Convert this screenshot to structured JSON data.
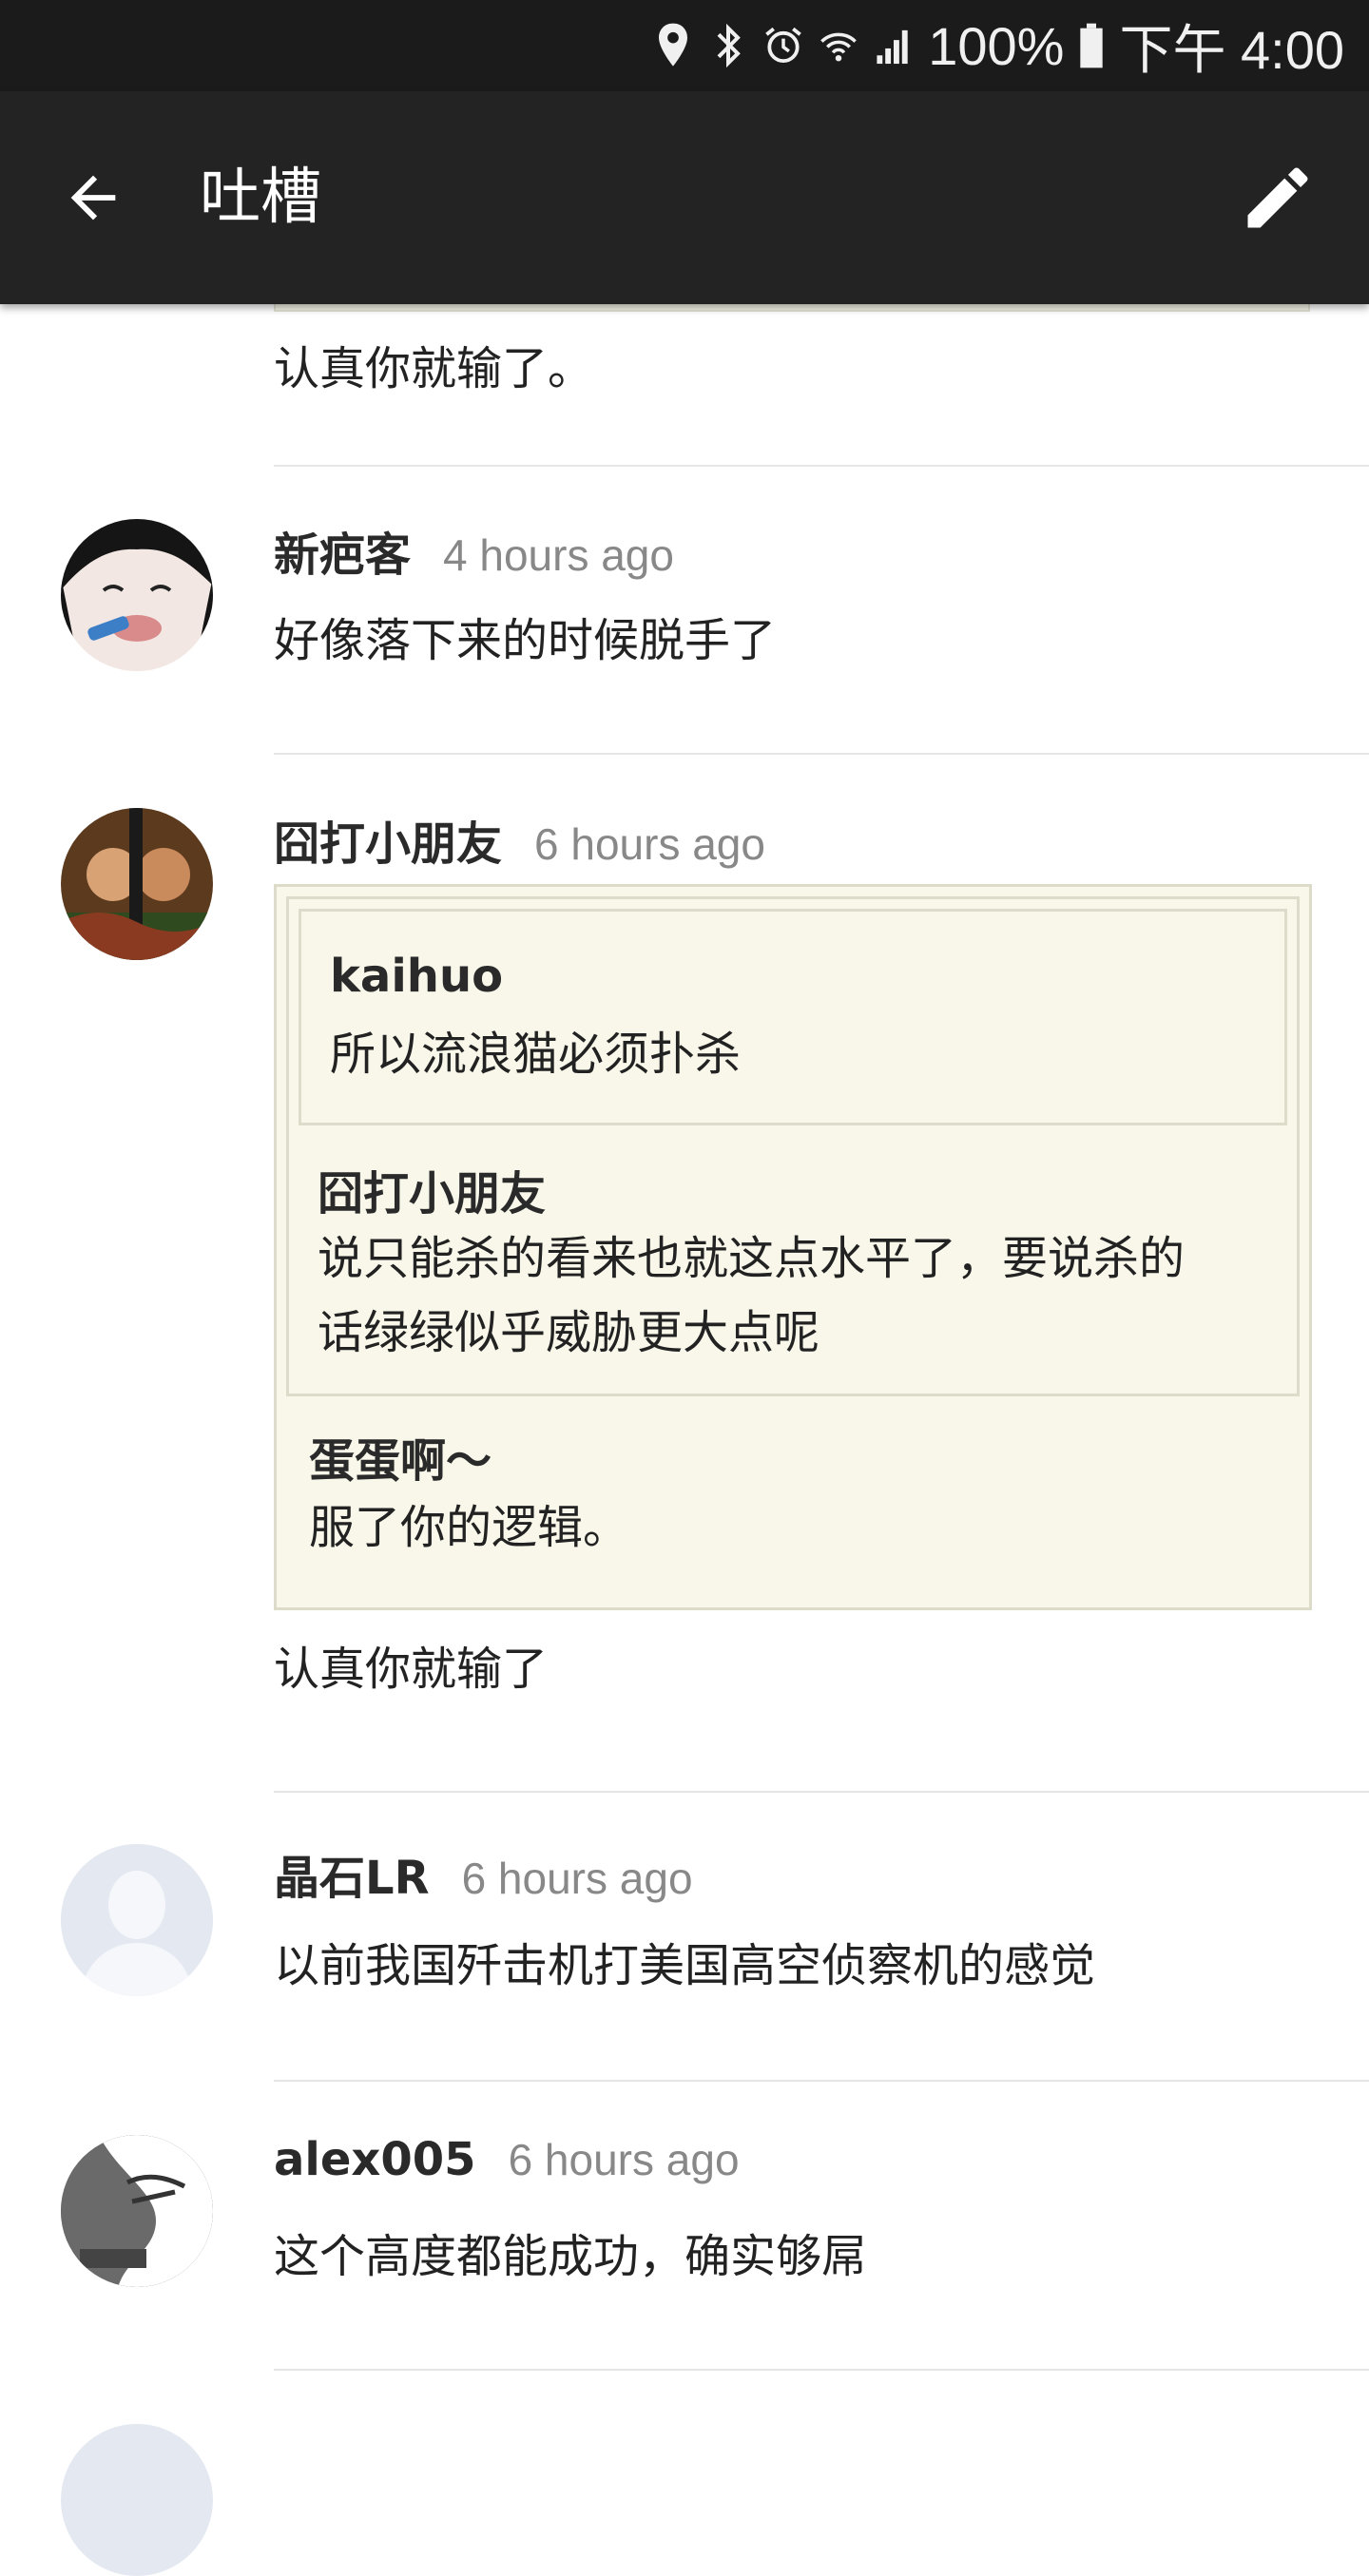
{
  "status_bar": {
    "battery": "100%",
    "time": "下午 4:00",
    "icons": [
      "location-icon",
      "bluetooth-icon",
      "alarm-icon",
      "wifi-icon",
      "signal-icon",
      "battery-icon"
    ]
  },
  "app_bar": {
    "title": "吐槽",
    "back_icon": "arrow-back-icon",
    "edit_icon": "pencil-icon"
  },
  "partial_comment": {
    "text": "认真你就输了。"
  },
  "comments": [
    {
      "author": "新疤客",
      "time": "4 hours ago",
      "text": "好像落下来的时候脱手了",
      "avatar": "cartoon-girl-avatar"
    },
    {
      "author": "囧打小朋友",
      "time": "6 hours ago",
      "avatar": "portrait-avatar",
      "quotes": [
        {
          "author": "kaihuo",
          "text": "所以流浪猫必须扑杀"
        },
        {
          "author": "囧打小朋友",
          "text_line1": "说只能杀的看来也就这点水平了，要说杀的",
          "text_line2": "话绿绿似乎威胁更大点呢"
        },
        {
          "author": "蛋蛋啊～",
          "text": "服了你的逻辑。"
        }
      ],
      "text": "认真你就输了"
    },
    {
      "author": "晶石LR",
      "time": "6 hours ago",
      "text": "以前我国歼击机打美国高空侦察机的感觉",
      "avatar": "default-avatar"
    },
    {
      "author": "alex005",
      "time": "6 hours ago",
      "text": "这个高度都能成功，确实够屌",
      "avatar": "sketch-avatar"
    }
  ]
}
